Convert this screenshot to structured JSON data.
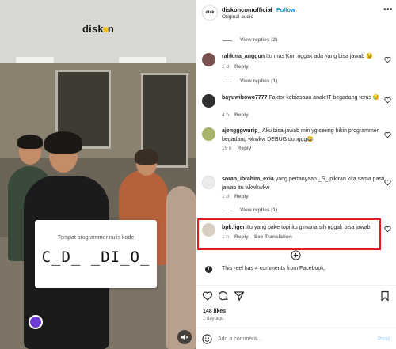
{
  "video": {
    "brand_text": "disk",
    "brand_text_tail": "n",
    "card_title": "Tempat programmer nulis kode",
    "card_puzzle": "C_D_ _DI_O_",
    "mute_icon": "speaker-muted-icon",
    "brand_accent": "#f2c21d"
  },
  "header": {
    "avatar_text": "disk",
    "username": "diskoncomofficial",
    "separator": "•",
    "follow_label": "Follow",
    "audio": "Original audio",
    "more_icon": "ellipsis-icon"
  },
  "comments": [
    {
      "type": "replies",
      "label": "View replies (2)"
    },
    {
      "username": "rahkma_anggun",
      "text": "Itu mas Kon nggak ada yang bisa jawab 😉",
      "time": "1 d",
      "reply": "Reply"
    },
    {
      "type": "replies",
      "label": "View replies (1)"
    },
    {
      "username": "bayuwibowo7777",
      "text": "Faktor kebiasaan anak IT begadang terus 😢",
      "time": "4 h",
      "reply": "Reply"
    },
    {
      "username": "ajengggwurip_",
      "text": "Aku bisa jawab min yg sering bikin programmer begadang wkwkw DEBUG donggg😂",
      "time": "15 h",
      "reply": "Reply"
    },
    {
      "username": "soran_ibrahim_exia",
      "text": "yang pertanyaan _S_ pikiran kita sama pasti jawab itu wkwkwkw",
      "time": "1 d",
      "reply": "Reply"
    },
    {
      "type": "replies",
      "label": "View replies (1)"
    },
    {
      "username": "bpk.liger",
      "text": "Itu yang pake topi itu gimana sih nggak bisa jawab",
      "time": "1 h",
      "reply": "Reply",
      "see_translation": "See Translation"
    }
  ],
  "facebook_note": "This reel has 4 comments from Facebook.",
  "likes": "148 likes",
  "posted": "1 day ago",
  "add_comment_placeholder": "Add a comment…",
  "post_label": "Post",
  "colors": {
    "follow": "#0095f6",
    "highlight": "#e41e1e",
    "post_disabled": "#b3dbff"
  }
}
